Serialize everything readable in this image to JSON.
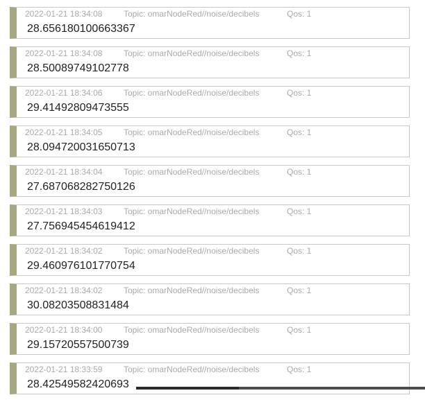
{
  "messages": [
    {
      "timestamp": "2022-01-21 18:34:08",
      "topic": "Topic: omarNodeRed//noise/decibels",
      "qos": "Qos: 1",
      "payload": "28.656180100663367"
    },
    {
      "timestamp": "2022-01-21 18:34:08",
      "topic": "Topic: omarNodeRed//noise/decibels",
      "qos": "Qos: 1",
      "payload": "28.50089749102778"
    },
    {
      "timestamp": "2022-01-21 18:34:06",
      "topic": "Topic: omarNodeRed//noise/decibels",
      "qos": "Qos: 1",
      "payload": "29.41492809473555"
    },
    {
      "timestamp": "2022-01-21 18:34:05",
      "topic": "Topic: omarNodeRed//noise/decibels",
      "qos": "Qos: 1",
      "payload": "28.094720031650713"
    },
    {
      "timestamp": "2022-01-21 18:34:04",
      "topic": "Topic: omarNodeRed//noise/decibels",
      "qos": "Qos: 1",
      "payload": "27.687068282750126"
    },
    {
      "timestamp": "2022-01-21 18:34:03",
      "topic": "Topic: omarNodeRed//noise/decibels",
      "qos": "Qos: 1",
      "payload": "27.756945454619412"
    },
    {
      "timestamp": "2022-01-21 18:34:02",
      "topic": "Topic: omarNodeRed//noise/decibels",
      "qos": "Qos: 1",
      "payload": "29.460976101770754"
    },
    {
      "timestamp": "2022-01-21 18:34:02",
      "topic": "Topic: omarNodeRed//noise/decibels",
      "qos": "Qos: 1",
      "payload": "30.08203508831484"
    },
    {
      "timestamp": "2022-01-21 18:34:00",
      "topic": "Topic: omarNodeRed//noise/decibels",
      "qos": "Qos: 1",
      "payload": "29.15720557500739"
    },
    {
      "timestamp": "2022-01-21 18:33:59",
      "topic": "Topic: omarNodeRed//noise/decibels",
      "qos": "Qos: 1",
      "payload": "28.42549582420693"
    }
  ],
  "colors": {
    "accent_bar": "#a7a882",
    "border": "#c8c8c8",
    "meta_text": "#a9a9a9",
    "payload_text": "#222222"
  }
}
